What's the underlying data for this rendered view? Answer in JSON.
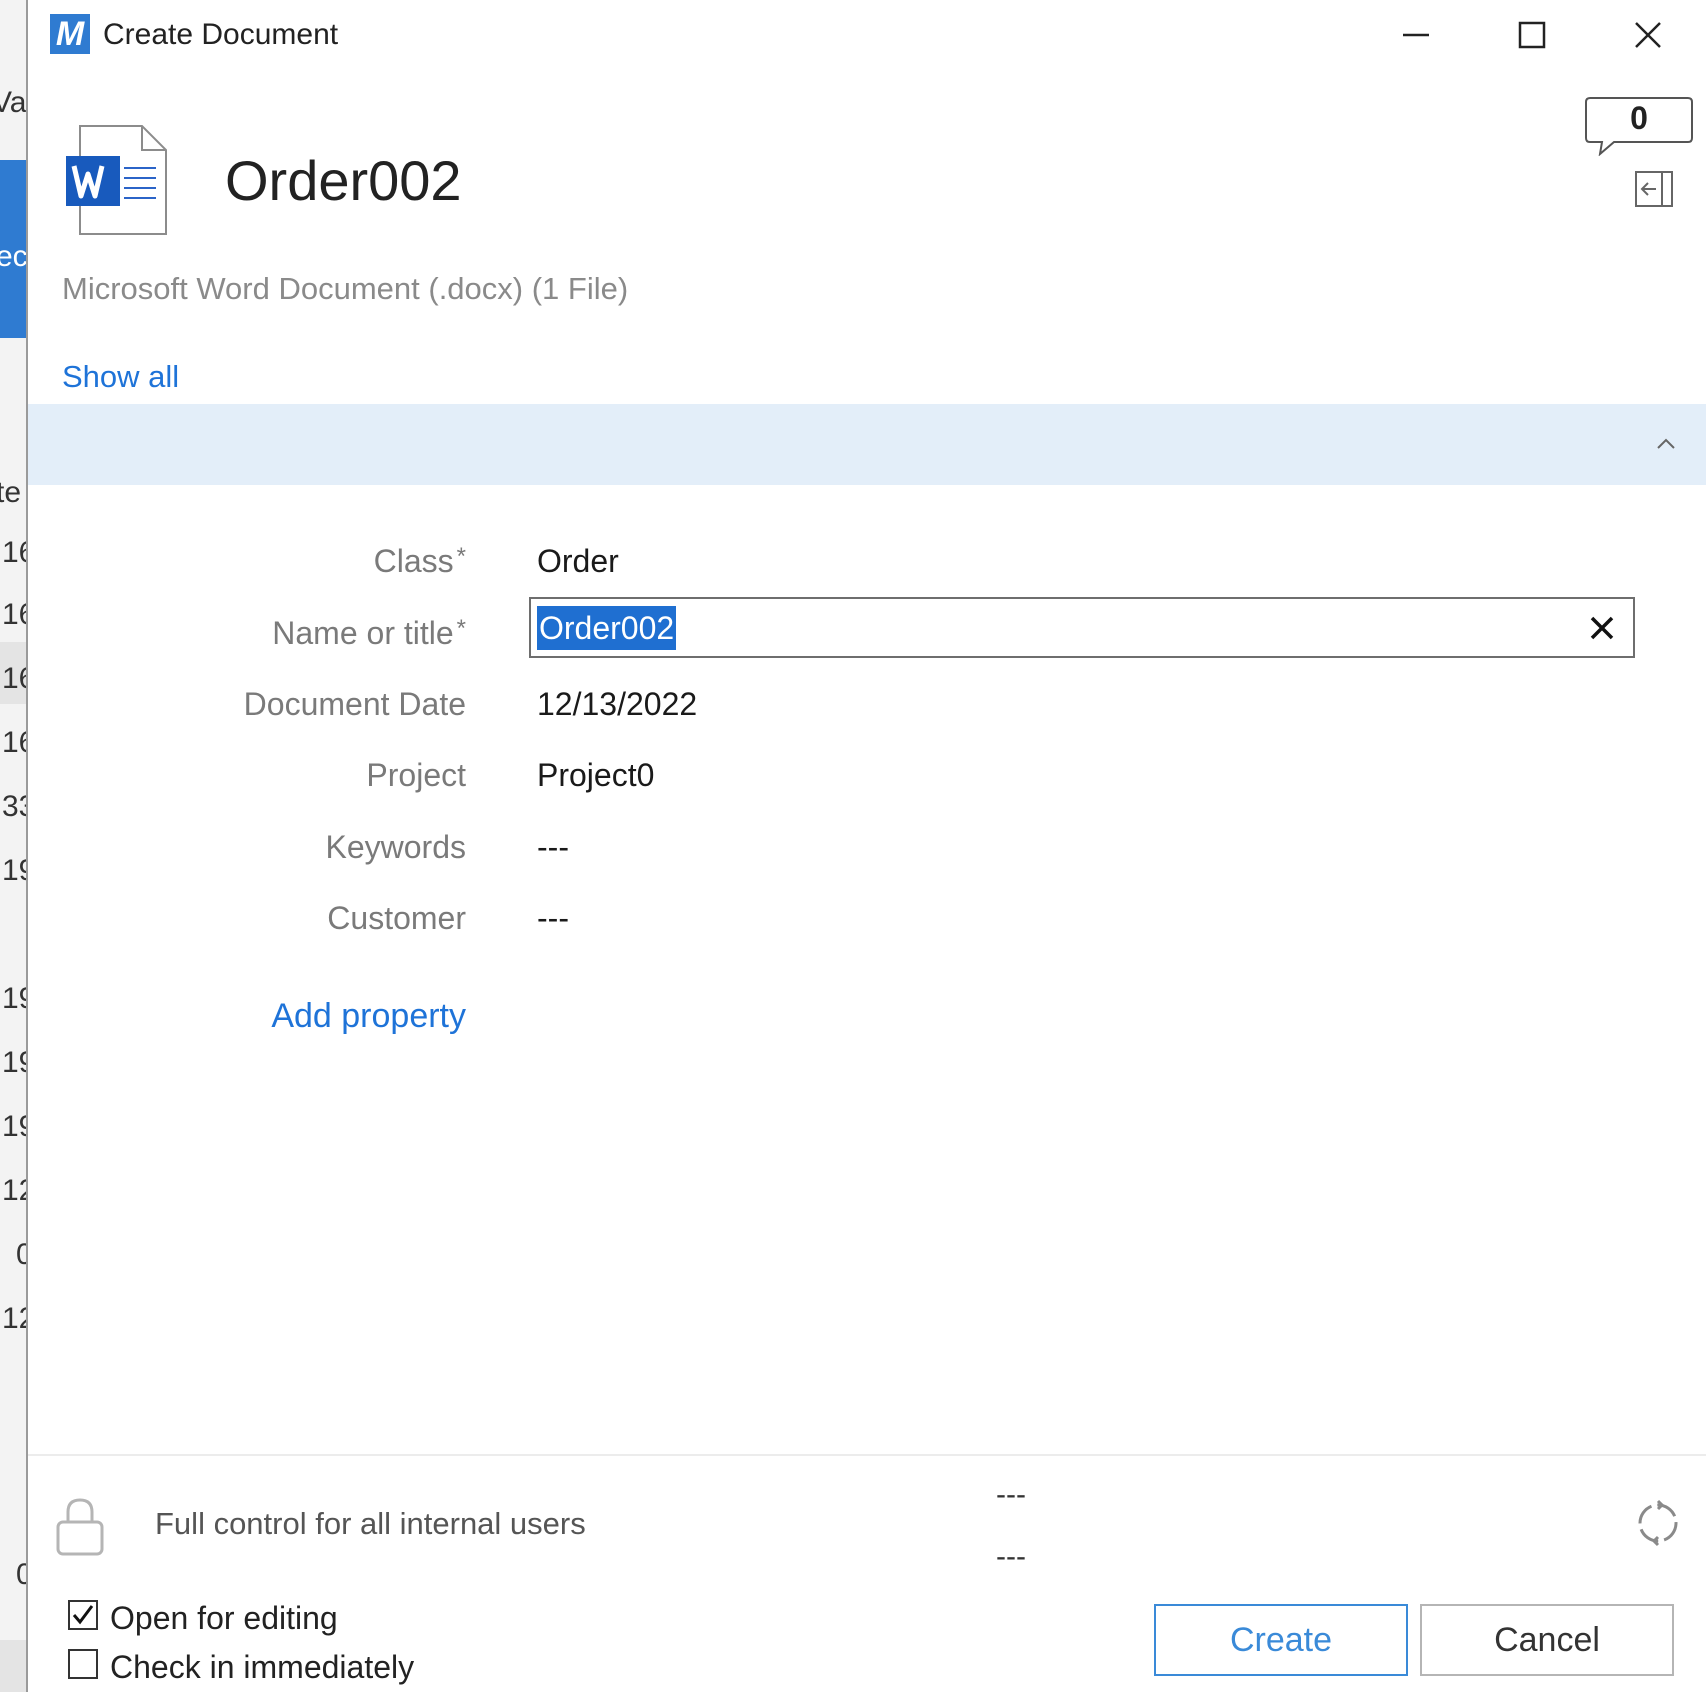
{
  "background_window": {
    "fragments": [
      "Vau",
      "ec",
      "te",
      "16",
      "16",
      "16",
      "16",
      "33",
      "19",
      "19",
      "19",
      "19",
      "12",
      "0",
      "12",
      "0"
    ]
  },
  "window": {
    "title": "Create Document",
    "app_logo": "M"
  },
  "header": {
    "doc_title": "Order002",
    "comment_count": "0",
    "file_description": "Microsoft Word Document (.docx) (1 File)",
    "show_all": "Show all"
  },
  "properties": [
    {
      "label": "Class",
      "required": "*",
      "value": "Order"
    },
    {
      "label": "Name or title",
      "required": "*",
      "value": "Order002"
    },
    {
      "label": "Document Date",
      "required": "",
      "value": "12/13/2022"
    },
    {
      "label": "Project",
      "required": "",
      "value": "Project0"
    },
    {
      "label": "Keywords",
      "required": "",
      "value": "---"
    },
    {
      "label": "Customer",
      "required": "",
      "value": "---"
    }
  ],
  "add_property": "Add property",
  "footer": {
    "permissions": "Full control for all internal users",
    "workflow_line1": "---",
    "workflow_line2": "---",
    "open_for_editing": {
      "label": "Open for editing",
      "checked": true
    },
    "check_in_immediately": {
      "label": "Check in immediately",
      "checked": false
    },
    "create_button": "Create",
    "cancel_button": "Cancel"
  },
  "colors": {
    "accent": "#1e73d8",
    "section_bar": "#e3eef9",
    "selection": "#1f6fd1",
    "word_blue": "#185abd"
  },
  "icons": [
    "app-logo-icon",
    "minimize-icon",
    "maximize-icon",
    "close-icon",
    "word-document-icon",
    "comment-icon",
    "pane-toggle-icon",
    "chevron-up-icon",
    "clear-icon",
    "lock-icon",
    "workflow-icon",
    "checkbox-icon"
  ]
}
